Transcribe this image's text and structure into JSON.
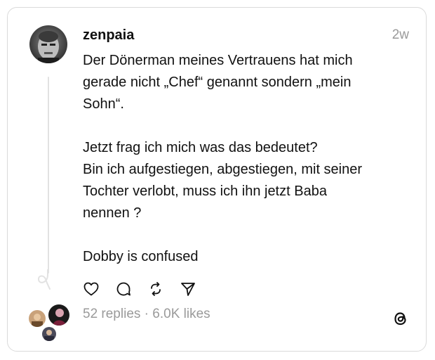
{
  "post": {
    "username": "zenpaia",
    "timestamp": "2w",
    "text": "Der Dönerman meines Vertrauens hat mich\ngerade nicht „Chef“ genannt sondern „mein\nSohn“.\n\nJetzt frag ich mich was das bedeutet?\nBin ich aufgestiegen, abgestiegen, mit seiner\nTochter verlobt, muss ich ihn jetzt Baba\nnennen ?\n\nDobby is confused"
  },
  "actions": {
    "like_icon": "heart-icon",
    "reply_icon": "comment-icon",
    "repost_icon": "repost-icon",
    "share_icon": "send-icon"
  },
  "stats": {
    "replies": "52 replies",
    "separator": " · ",
    "likes": "6.0K likes"
  },
  "colors": {
    "text": "#111111",
    "muted": "#9a9a9a",
    "border": "#dadada",
    "thread_line": "#e2e2e2"
  },
  "brand": {
    "logo_icon": "threads-logo-icon"
  }
}
